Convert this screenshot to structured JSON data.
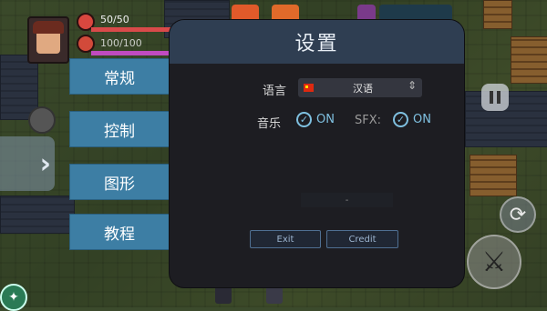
{
  "hud": {
    "hp": "50/50",
    "mp": "100/100"
  },
  "menu_tabs": [
    {
      "label": "常规"
    },
    {
      "label": "控制"
    },
    {
      "label": "图形"
    },
    {
      "label": "教程"
    }
  ],
  "dialog": {
    "title": "设置",
    "language_label": "语言",
    "language_value": "汉语",
    "music_label": "音乐",
    "music_value": "ON",
    "sfx_label": "SFX:",
    "sfx_value": "ON",
    "blank_value": "-",
    "exit_label": "Exit",
    "credit_label": "Credit"
  },
  "icons": {
    "flag": "china-flag-icon",
    "check": "check-circle-icon",
    "pause": "pause-icon",
    "swap": "swap-weapon-icon",
    "attack": "sword-attack-icon"
  },
  "colors": {
    "tab_bg": "#3d7ea4",
    "dialog_bg": "#1d1d22",
    "header_bg": "#2f3e52",
    "accent": "#7fc0e0"
  }
}
